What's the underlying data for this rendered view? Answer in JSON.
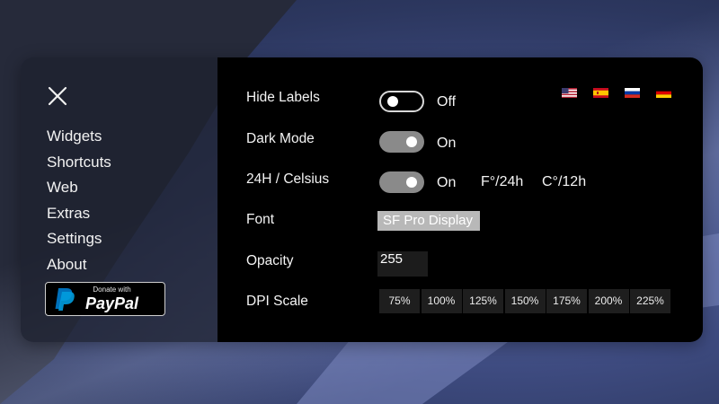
{
  "sidebar": {
    "nav": [
      "Widgets",
      "Shortcuts",
      "Web",
      "Extras",
      "Settings",
      "About"
    ],
    "donate": {
      "top": "Donate with",
      "brand": "PayPal"
    }
  },
  "settings": {
    "hide_labels": {
      "label": "Hide Labels",
      "state": "Off",
      "enabled": false
    },
    "dark_mode": {
      "label": "Dark Mode",
      "state": "On",
      "enabled": true
    },
    "time_temp": {
      "label": "24H / Celsius",
      "state": "On",
      "enabled": true,
      "options": [
        "F°/24h",
        "C°/12h"
      ]
    },
    "font": {
      "label": "Font",
      "value": "SF Pro Display"
    },
    "opacity": {
      "label": "Opacity",
      "value": "255"
    },
    "dpi": {
      "label": "DPI Scale",
      "options": [
        "75%",
        "100%",
        "125%",
        "150%",
        "175%",
        "200%",
        "225%"
      ]
    }
  },
  "languages": [
    "us-flag-icon",
    "es-flag-icon",
    "ru-flag-icon",
    "de-flag-icon"
  ],
  "colors": {
    "panel_bg": "#000000",
    "toggle_on": "#8a8a8a",
    "font_field": "#b8b8b8",
    "paypal_blue": "#009cde"
  }
}
